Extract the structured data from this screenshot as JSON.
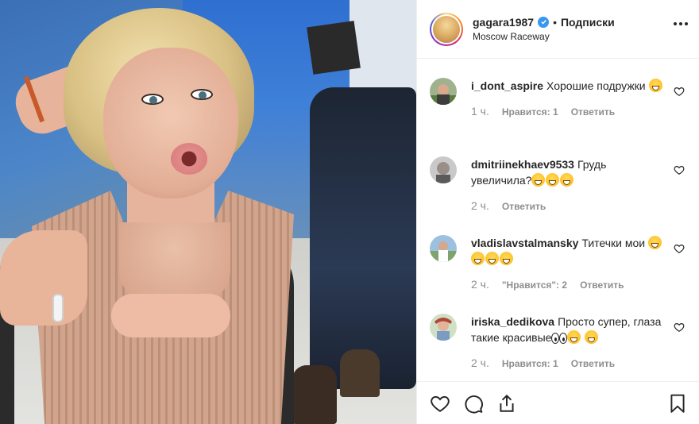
{
  "header": {
    "username": "gagara1987",
    "separator": "•",
    "follow_label": "Подписки",
    "location": "Moscow Raceway"
  },
  "comments": [
    {
      "username": "i_dont_aspire",
      "text": "Хорошие подружки",
      "emoji_count": 1,
      "time": "1 ч.",
      "likes": "Нравится: 1",
      "reply": "Ответить"
    },
    {
      "username": "dmitriinekhaev9533",
      "text": "Грудь увеличила?",
      "emoji_count": 3,
      "time": "2 ч.",
      "likes": "",
      "reply": "Ответить"
    },
    {
      "username": "vladislavstalmansky",
      "text": "Титечки мои",
      "emoji_count": 4,
      "time": "2 ч.",
      "likes": "\"Нравится\": 2",
      "reply": "Ответить"
    },
    {
      "username": "iriska_dedikova",
      "text": "Просто супер, глаза такие красивые",
      "emoji_count": 2,
      "time": "2 ч.",
      "likes": "Нравится: 1",
      "reply": "Ответить"
    }
  ],
  "actions": {
    "icons": [
      "heart-icon",
      "comment-icon",
      "share-icon",
      "bookmark-icon"
    ]
  },
  "colors": {
    "verified": "#3897f0",
    "text": "#262626",
    "muted": "#8e8e8e",
    "border": "#efefef"
  }
}
